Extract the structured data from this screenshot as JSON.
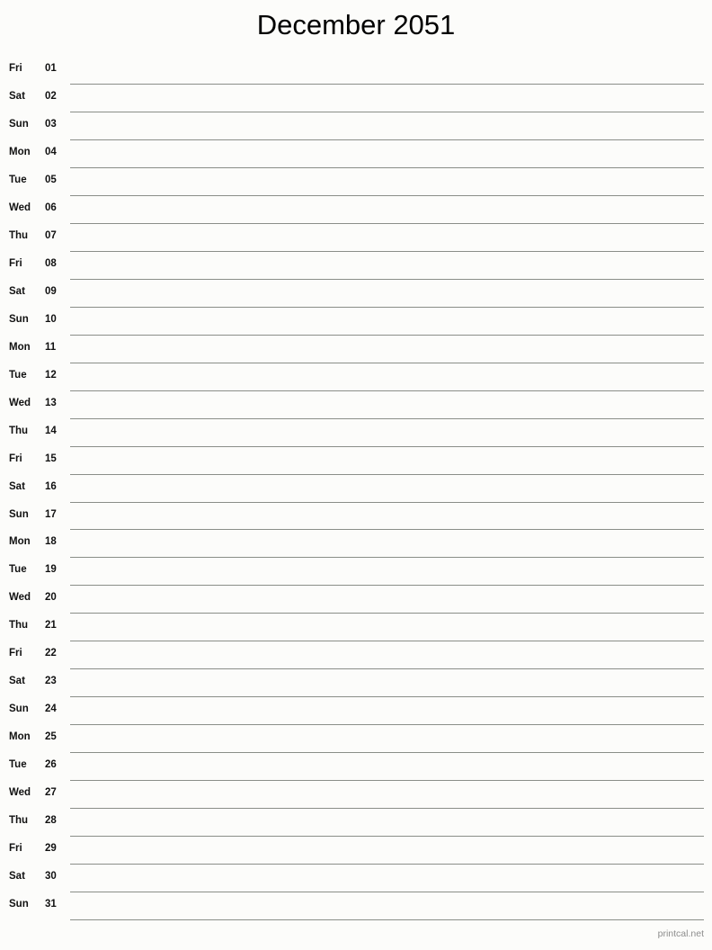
{
  "document": {
    "title": "December 2051",
    "month": "December",
    "year": "2051"
  },
  "calendar": {
    "days": [
      {
        "weekday": "Fri",
        "date": "01"
      },
      {
        "weekday": "Sat",
        "date": "02"
      },
      {
        "weekday": "Sun",
        "date": "03"
      },
      {
        "weekday": "Mon",
        "date": "04"
      },
      {
        "weekday": "Tue",
        "date": "05"
      },
      {
        "weekday": "Wed",
        "date": "06"
      },
      {
        "weekday": "Thu",
        "date": "07"
      },
      {
        "weekday": "Fri",
        "date": "08"
      },
      {
        "weekday": "Sat",
        "date": "09"
      },
      {
        "weekday": "Sun",
        "date": "10"
      },
      {
        "weekday": "Mon",
        "date": "11"
      },
      {
        "weekday": "Tue",
        "date": "12"
      },
      {
        "weekday": "Wed",
        "date": "13"
      },
      {
        "weekday": "Thu",
        "date": "14"
      },
      {
        "weekday": "Fri",
        "date": "15"
      },
      {
        "weekday": "Sat",
        "date": "16"
      },
      {
        "weekday": "Sun",
        "date": "17"
      },
      {
        "weekday": "Mon",
        "date": "18"
      },
      {
        "weekday": "Tue",
        "date": "19"
      },
      {
        "weekday": "Wed",
        "date": "20"
      },
      {
        "weekday": "Thu",
        "date": "21"
      },
      {
        "weekday": "Fri",
        "date": "22"
      },
      {
        "weekday": "Sat",
        "date": "23"
      },
      {
        "weekday": "Sun",
        "date": "24"
      },
      {
        "weekday": "Mon",
        "date": "25"
      },
      {
        "weekday": "Tue",
        "date": "26"
      },
      {
        "weekday": "Wed",
        "date": "27"
      },
      {
        "weekday": "Thu",
        "date": "28"
      },
      {
        "weekday": "Fri",
        "date": "29"
      },
      {
        "weekday": "Sat",
        "date": "30"
      },
      {
        "weekday": "Sun",
        "date": "31"
      }
    ]
  },
  "footer": {
    "credit": "printcal.net"
  },
  "colors": {
    "background": "#fcfcfa",
    "text": "#111111",
    "rule_line": "#8a8e88",
    "footer_text": "#8d8d8d"
  }
}
